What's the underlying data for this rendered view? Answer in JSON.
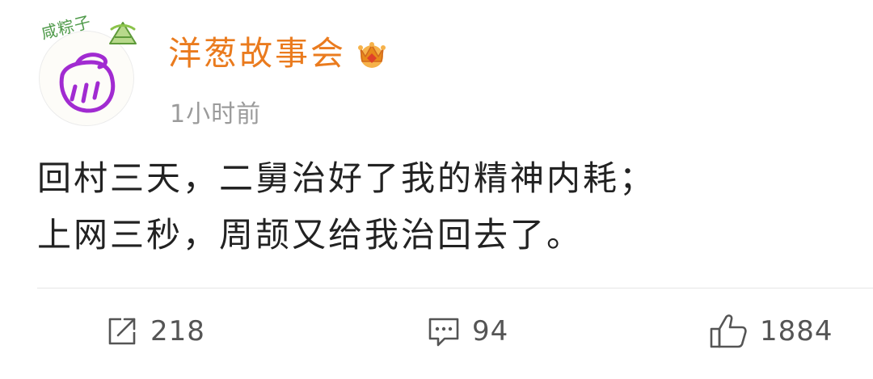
{
  "post": {
    "pendant_label": "咸粽子",
    "username": "洋葱故事会",
    "timestamp": "1小时前",
    "content_lines": [
      "回村三天，二舅治好了我的精神内耗；",
      "上网三秒，周颉又给我治回去了。"
    ],
    "icons": {
      "avatar": "onion-avatar-icon",
      "pendant": "zongzi-icon",
      "vip": "crown-icon",
      "repost": "repost-icon",
      "comment": "comment-icon",
      "like": "thumbs-up-icon"
    }
  },
  "actions": {
    "repost_count": "218",
    "comment_count": "94",
    "like_count": "1884"
  },
  "colors": {
    "username": "#ea7b1e",
    "avatar_stroke": "#a12bd1",
    "pendant_green": "#4f9a4a",
    "text": "#222222",
    "meta": "#9b9b9b"
  }
}
